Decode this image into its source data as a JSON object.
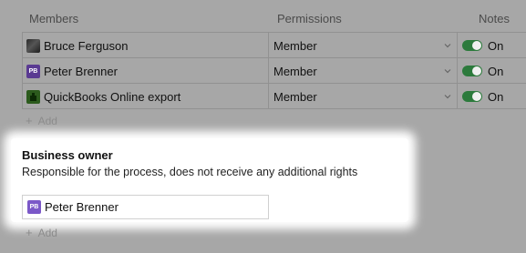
{
  "headers": {
    "members": "Members",
    "permissions": "Permissions",
    "notes": "Notes"
  },
  "members": [
    {
      "name": "Bruce Ferguson",
      "avatar": "photo",
      "permission": "Member",
      "notes": "On"
    },
    {
      "name": "Peter Brenner",
      "avatar": "PB",
      "permission": "Member",
      "notes": "On"
    },
    {
      "name": "QuickBooks Online export",
      "avatar": "quickbooks-icon",
      "permission": "Member",
      "notes": "On"
    }
  ],
  "add_label": "Add",
  "business_owner": {
    "title": "Business owner",
    "description": "Responsible for the process, does not receive any additional rights",
    "value": "Peter Brenner",
    "avatar": "PB"
  },
  "add_label_2": "Add"
}
